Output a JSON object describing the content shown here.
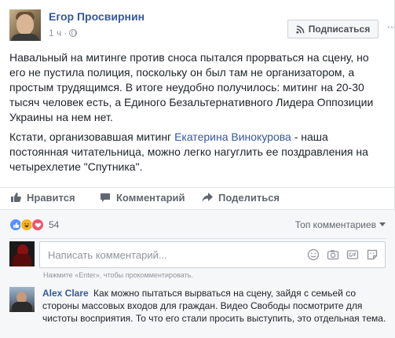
{
  "post": {
    "author": "Егор Просвирнин",
    "time": "1 ч",
    "subscribe_label": "Подписаться",
    "paragraph1": "Навальный на митинге против сноса пытался прорваться на сцену, но его не пустила полиция, поскольку он был там не организатором, а простым трудящимся. В итоге неудобно получилось: митинг на 20-30 тысяч человек есть, а Единого Безальтернативного Лидера Оппозиции Украины на нем нет.",
    "paragraph2_before": "Кстати, организовавшая митинг ",
    "paragraph2_link": "Екатерина Винокурова",
    "paragraph2_after": " - наша постоянная читательница, можно легко нагуглить ее поздравления на четырехлетие \"Спутника\"."
  },
  "actions": {
    "like_label": "Нравится",
    "comment_label": "Комментарий",
    "share_label": "Поделиться"
  },
  "reactions": {
    "count": "54",
    "sort_label": "Топ комментариев",
    "colors": {
      "like": "#5890ff",
      "haha": "#f7b125",
      "love": "#f25268"
    }
  },
  "comment_box": {
    "placeholder": "Написать комментарий...",
    "hint": "Нажмите «Enter», чтобы прокомментировать."
  },
  "comment": {
    "author": "Alex Clare",
    "text": "Как можно пытаться вырваться на сцену, зайдя с семьей со стороны массовых входов для граждан. Видео Свободы посмотрите для чистоты восприятия. То что его стали просить выступить, это отдельная тема."
  },
  "icons": [
    "globe-icon",
    "rss-icon",
    "more-icon",
    "like-icon",
    "comment-icon",
    "share-icon",
    "emoji-icon",
    "camera-icon",
    "gif-icon",
    "sticker-icon"
  ],
  "colors": {
    "link": "#365899",
    "text": "#1d2129",
    "muted": "#90949c",
    "accent": "#4267b2"
  }
}
